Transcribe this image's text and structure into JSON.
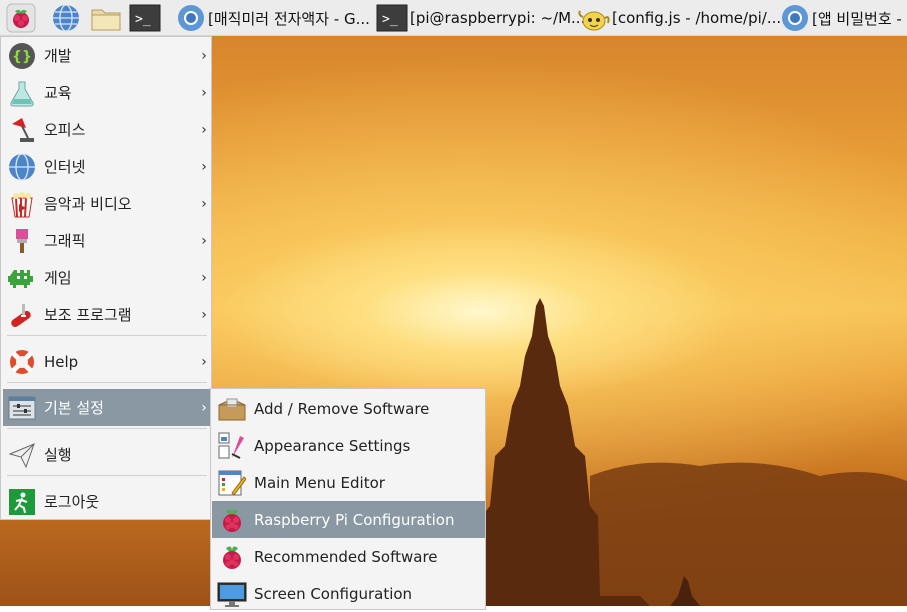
{
  "taskbar": {
    "launchers": [
      {
        "icon": "raspberry-menu-icon"
      },
      {
        "icon": "globe-browser-icon"
      },
      {
        "icon": "folder-icon"
      },
      {
        "icon": "terminal-icon"
      }
    ],
    "tasks": [
      {
        "icon": "chromium-icon",
        "label": "[매직미러 전자액자 - G..."
      },
      {
        "icon": "terminal-icon",
        "label": "[pi@raspberrypi: ~/M..."
      },
      {
        "icon": "geany-teapot-icon",
        "label": "[config.js - /home/pi/..."
      },
      {
        "icon": "chromium-icon",
        "label": "[앱 비밀번호 -"
      }
    ]
  },
  "main_menu": {
    "items": [
      {
        "label": "개발",
        "icon": "programming-braces-icon",
        "submenu": true
      },
      {
        "label": "교육",
        "icon": "flask-icon",
        "submenu": true
      },
      {
        "label": "오피스",
        "icon": "desk-lamp-icon",
        "submenu": true
      },
      {
        "label": "인터넷",
        "icon": "globe-icon",
        "submenu": true
      },
      {
        "label": "음악과 비디오",
        "icon": "popcorn-icon",
        "submenu": true
      },
      {
        "label": "그래픽",
        "icon": "paintbrush-icon",
        "submenu": true
      },
      {
        "label": "게임",
        "icon": "space-invader-icon",
        "submenu": true
      },
      {
        "label": "보조 프로그램",
        "icon": "swiss-knife-icon",
        "submenu": true
      },
      {
        "label": "Help",
        "icon": "lifebuoy-icon",
        "submenu": true
      },
      {
        "label": "기본 설정",
        "icon": "preferences-sliders-icon",
        "submenu": true,
        "selected": true
      },
      {
        "label": "실행",
        "icon": "paper-plane-icon",
        "submenu": false
      },
      {
        "label": "로그아웃",
        "icon": "exit-running-man-icon",
        "submenu": false
      }
    ],
    "arrow": "›"
  },
  "sub_menu": {
    "items": [
      {
        "label": "Add / Remove Software",
        "icon": "package-box-icon"
      },
      {
        "label": "Appearance Settings",
        "icon": "appearance-palette-icon"
      },
      {
        "label": "Main Menu Editor",
        "icon": "menu-editor-icon"
      },
      {
        "label": "Raspberry Pi Configuration",
        "icon": "raspberry-icon",
        "selected": true
      },
      {
        "label": "Recommended Software",
        "icon": "raspberry-icon"
      },
      {
        "label": "Screen Configuration",
        "icon": "monitor-icon"
      }
    ]
  },
  "colors": {
    "selection": "#8a98a3",
    "menu_bg": "#f4f4f4",
    "taskbar_bg": "#ececec",
    "raspberry": "#c51a4a"
  }
}
